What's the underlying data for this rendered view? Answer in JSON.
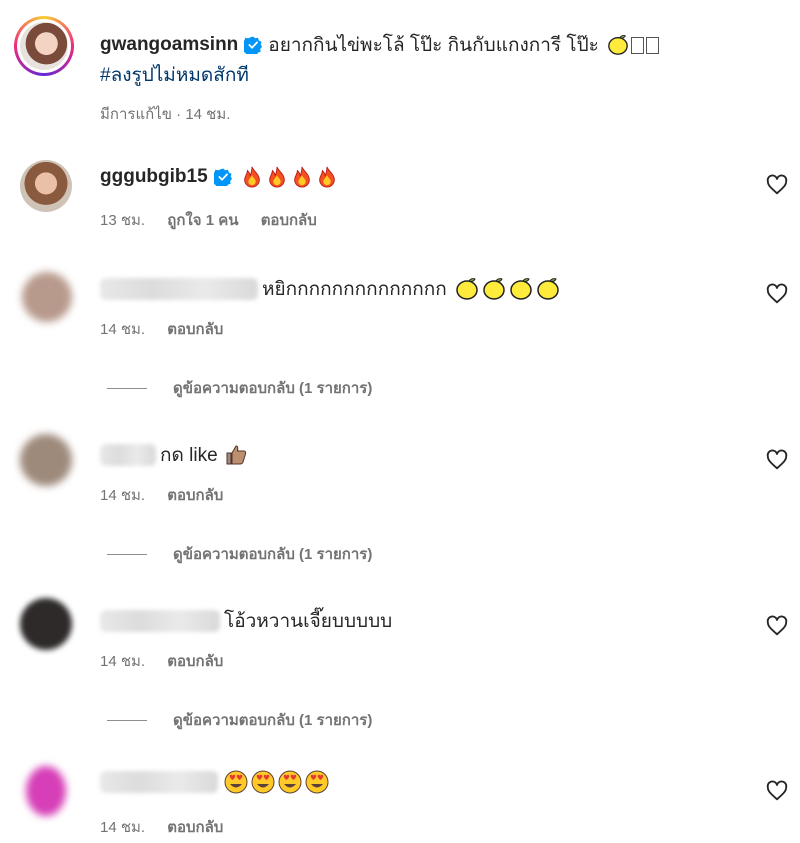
{
  "post": {
    "username": "gwangoamsinn",
    "caption": "อยากกินไข่พะโล้ โป๊ะ กินกับแกงการี โป๊ะ",
    "hashtag": "#ลงรูปไม่หมดสักที",
    "meta": "มีการแก้ไข · 14 ชม."
  },
  "comments": [
    {
      "username": "gggubgib15",
      "text": "",
      "time": "13 ชม.",
      "likes": "ถูกใจ 1 คน",
      "reply": "ตอบกลับ",
      "emoji": "fire",
      "emoji_count": 4
    },
    {
      "username": "",
      "text": "หยิกกกกกกกกกกกกกก",
      "time": "14 ชม.",
      "reply": "ตอบกลับ",
      "emoji": "lemon",
      "emoji_count": 4,
      "view_replies": "ดูข้อความตอบกลับ (1 รายการ)"
    },
    {
      "username": "",
      "text": "กด like",
      "time": "14 ชม.",
      "reply": "ตอบกลับ",
      "emoji": "thumbs-up",
      "emoji_count": 1,
      "view_replies": "ดูข้อความตอบกลับ (1 รายการ)"
    },
    {
      "username": "",
      "text": "โอ้วหวานเจี๊ยบบบบบ",
      "time": "14 ชม.",
      "reply": "ตอบกลับ",
      "view_replies": "ดูข้อความตอบกลับ (1 รายการ)"
    },
    {
      "username": "",
      "text": "",
      "time": "14 ชม.",
      "reply": "ตอบกลับ",
      "emoji": "heart-eyes",
      "emoji_count": 4
    }
  ],
  "colors": {
    "verified": "#0095f6",
    "ring_start": "#f9ce34",
    "ring_mid": "#ee2a7b",
    "ring_end": "#6228d7",
    "meta": "#737373"
  }
}
